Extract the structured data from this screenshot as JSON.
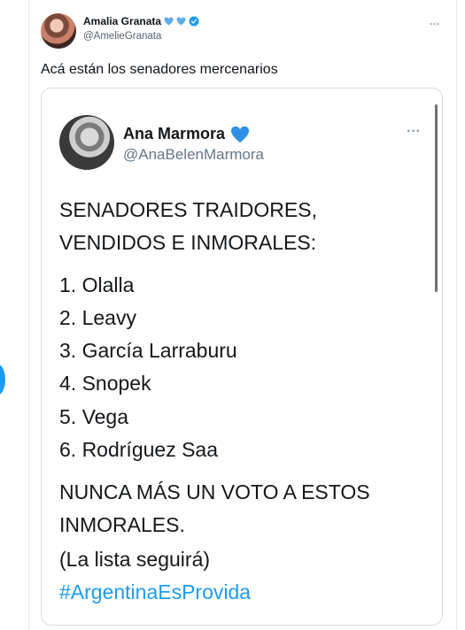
{
  "tweet": {
    "display_name": "Amalia Granata",
    "handle": "@AmelieGranata",
    "more": "···",
    "text": "Acá están los senadores mercenarios"
  },
  "quoted": {
    "display_name": "Ana Marmora",
    "handle": "@AnaBelenMarmora",
    "more": "···",
    "lines": [
      "SENADORES TRAIDORES,",
      "VENDIDOS E INMORALES:",
      "1. Olalla",
      "2. Leavy",
      "3. García Larraburu",
      "4. Snopek",
      "5. Vega",
      "6. Rodríguez Saa",
      "NUNCA MÁS UN VOTO A ESTOS",
      "INMORALES.",
      "(La lista seguirá)"
    ],
    "hashtag": "#ArgentinaEsProvida"
  },
  "colors": {
    "heart": "#5dadec",
    "verified": "#1d9bf0",
    "link": "#1d9bf0"
  },
  "icons": [
    "blue-heart-icon",
    "verified-badge-icon",
    "more-icon"
  ]
}
